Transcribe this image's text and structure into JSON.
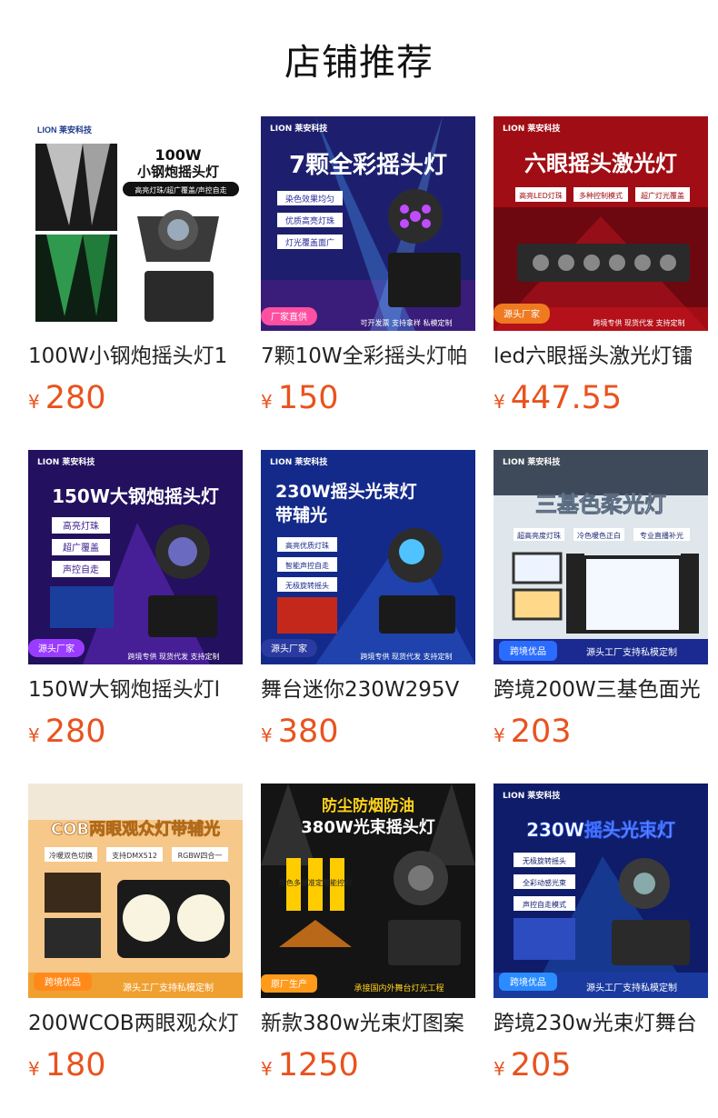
{
  "section_title": "店铺推荐",
  "products": [
    {
      "name": "100W小钢炮摇头灯1",
      "currency": "¥",
      "price": "280",
      "image": {
        "brand": "LION 莱安科技",
        "headline": "100W",
        "headline2": "小钢炮摇头灯",
        "features": [
          "高亮灯珠/超广覆盖/声控自走"
        ],
        "badge": "",
        "footer": ""
      }
    },
    {
      "name": "7颗10W全彩摇头灯帕",
      "currency": "¥",
      "price": "150",
      "image": {
        "brand": "LION 莱安科技",
        "headline": "7颗全彩摇头灯",
        "headline2": "",
        "features": [
          "染色效果均匀",
          "优质高亮灯珠",
          "灯光覆盖面广"
        ],
        "badge": "厂家直供",
        "footer": "可开发票  支持拿样  私模定制"
      }
    },
    {
      "name": "led六眼摇头激光灯镭",
      "currency": "¥",
      "price": "447.55",
      "image": {
        "brand": "LION 莱安科技",
        "headline": "六眼摇头激光灯",
        "headline2": "",
        "features": [
          "高亮LED灯珠",
          "多种控制模式",
          "超广灯光覆盖"
        ],
        "badge": "源头厂家",
        "footer": "跨境专供  现货代发  支持定制"
      }
    },
    {
      "name": "150W大钢炮摇头灯l",
      "currency": "¥",
      "price": "280",
      "image": {
        "brand": "LION 莱安科技",
        "headline": "150W大钢炮摇头灯",
        "headline2": "",
        "features": [
          "高亮灯珠",
          "超广覆盖",
          "声控自走"
        ],
        "badge": "源头厂家",
        "footer": "跨境专供  现货代发  支持定制"
      }
    },
    {
      "name": "舞台迷你230W295V",
      "currency": "¥",
      "price": "380",
      "image": {
        "brand": "LION 莱安科技",
        "headline": "230W摇头光束灯",
        "headline2": "带辅光",
        "features": [
          "高亮优质灯珠",
          "智能声控自走",
          "无极旋转摇头"
        ],
        "badge": "源头厂家",
        "footer": "跨境专供  现货代发  支持定制"
      }
    },
    {
      "name": "跨境200W三基色面光",
      "currency": "¥",
      "price": "203",
      "image": {
        "brand": "LION 莱安科技",
        "headline": "三基色柔光灯",
        "headline2": "",
        "features": [
          "超高亮度灯珠",
          "冷色暖色正白",
          "专业直播补光"
        ],
        "badge": "跨境优品",
        "footer": "源头工厂支持私模定制"
      }
    },
    {
      "name": "200WCOB两眼观众灯",
      "currency": "¥",
      "price": "180",
      "image": {
        "brand": "",
        "headline": "COB两眼观众灯带辅光",
        "headline2": "",
        "features": [
          "冷暖双色切换",
          "支持DMX512",
          "RGBW四合一"
        ],
        "badge": "跨境优品",
        "footer": "源头工厂支持私模定制"
      }
    },
    {
      "name": "新款380w光束灯图案",
      "currency": "¥",
      "price": "1250",
      "image": {
        "brand": "",
        "headline": "防尘防烟防油",
        "headline2": "380W光束摇头灯",
        "features": [
          "颜色多变",
          "精准定位",
          "智能控制"
        ],
        "badge": "原厂生产",
        "footer": "承接国内外舞台灯光工程"
      }
    },
    {
      "name": "跨境230w光束灯舞台",
      "currency": "¥",
      "price": "205",
      "image": {
        "brand": "LION 莱安科技",
        "headline": "230W摇头光束灯",
        "headline2": "",
        "features": [
          "无极旋转摇头",
          "全彩动感光束",
          "声控自走模式"
        ],
        "badge": "跨境优品",
        "footer": "源头工厂支持私模定制"
      }
    }
  ]
}
